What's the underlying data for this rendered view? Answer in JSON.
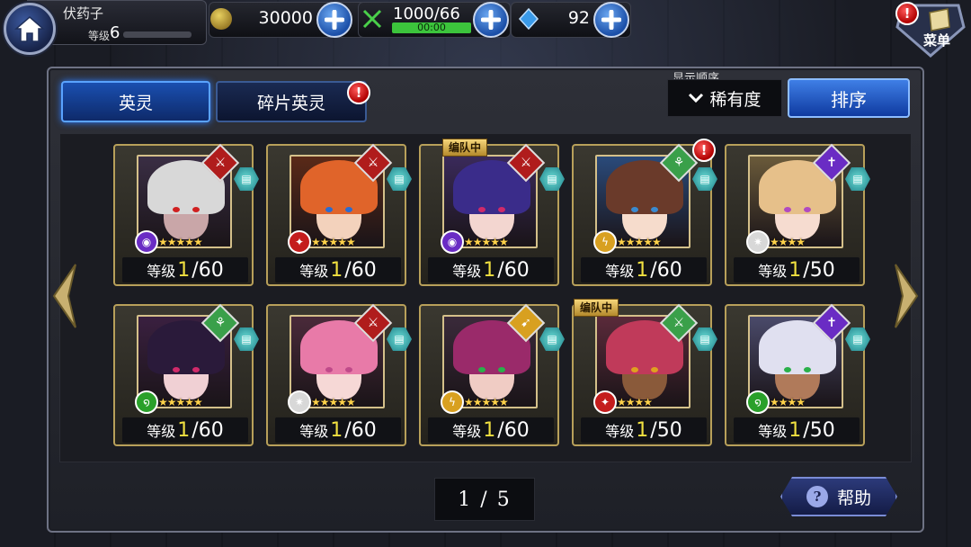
{
  "player": {
    "name": "伏药子",
    "level_label": "等级",
    "level": "6",
    "exp_progress": 0.0
  },
  "resources": {
    "coins": "30000",
    "stamina": "1000/66",
    "stamina_timer": "00:00",
    "gems": "92"
  },
  "menu": {
    "label": "菜单"
  },
  "tabs": [
    {
      "label": "英灵",
      "active": true
    },
    {
      "label": "碎片英灵",
      "active": false,
      "alert": "!"
    }
  ],
  "sort": {
    "caption": "显示顺序",
    "current": "稀有度",
    "button_label": "排序"
  },
  "heroes": [
    {
      "level_label": "等级",
      "level": "1",
      "max": "/60",
      "stars": "★★★★★",
      "class_color": "#b01c1c",
      "class_glyph": "⚔",
      "element_color": "#6a2cc4",
      "element_glyph": "◉",
      "hair": "#d8d8d8",
      "skin": "#c9a6a8",
      "eye": "#d02020",
      "bg": "#3a2e44"
    },
    {
      "level_label": "等级",
      "level": "1",
      "max": "/60",
      "stars": "★★★★★",
      "class_color": "#b01c1c",
      "class_glyph": "⚔",
      "element_color": "#c41c1c",
      "element_glyph": "✦",
      "hair": "#e0642a",
      "skin": "#f3d2bc",
      "eye": "#2a6cd0",
      "bg": "#5a2a18"
    },
    {
      "level_label": "等级",
      "level": "1",
      "max": "/60",
      "stars": "★★★★★",
      "class_color": "#b01c1c",
      "class_glyph": "⚔",
      "element_color": "#6a2cc4",
      "element_glyph": "◉",
      "hair": "#3a2c8a",
      "skin": "#f3d6d0",
      "eye": "#d02a6a",
      "bg": "#3a2a5a",
      "in_party": "编队中"
    },
    {
      "level_label": "等级",
      "level": "1",
      "max": "/60",
      "stars": "★★★★★",
      "class_color": "#3aa04a",
      "class_glyph": "⚘",
      "element_color": "#d8a020",
      "element_glyph": "ϟ",
      "hair": "#6a3a2a",
      "skin": "#f6dccc",
      "eye": "#3a8ad0",
      "bg": "#2a4a7a",
      "alert": "!"
    },
    {
      "level_label": "等级",
      "level": "1",
      "max": "/50",
      "stars": "★★★★",
      "class_color": "#6a2cc4",
      "class_glyph": "✝",
      "element_color": "#d8d8d8",
      "element_glyph": "✷",
      "hair": "#e6c08a",
      "skin": "#f6dcd0",
      "eye": "#b04ac0",
      "bg": "#6a5a3a"
    },
    {
      "level_label": "等级",
      "level": "1",
      "max": "/60",
      "stars": "★★★★★",
      "class_color": "#3aa04a",
      "class_glyph": "⚘",
      "element_color": "#2aa02a",
      "element_glyph": "໑",
      "hair": "#2a1a3a",
      "skin": "#f0d0d4",
      "eye": "#d02a6a",
      "bg": "#3a2040"
    },
    {
      "level_label": "等级",
      "level": "1",
      "max": "/60",
      "stars": "★★★★★",
      "class_color": "#b01c1c",
      "class_glyph": "⚔",
      "element_color": "#d8d8d8",
      "element_glyph": "✷",
      "hair": "#e87aa8",
      "skin": "#f6d8d6",
      "eye": "#c04a8a",
      "bg": "#4a2a3a"
    },
    {
      "level_label": "等级",
      "level": "1",
      "max": "/60",
      "stars": "★★★★★",
      "class_color": "#d8a020",
      "class_glyph": "➹",
      "element_color": "#d8a020",
      "element_glyph": "ϟ",
      "hair": "#9a2a6a",
      "skin": "#f0ccc4",
      "eye": "#2ab04a",
      "bg": "#3a2a3a"
    },
    {
      "level_label": "等级",
      "level": "1",
      "max": "/50",
      "stars": "★★★★",
      "class_color": "#3aa04a",
      "class_glyph": "⚔",
      "element_color": "#c41c1c",
      "element_glyph": "✦",
      "hair": "#c03a5a",
      "skin": "#8a5a3a",
      "eye": "#e0a020",
      "bg": "#5a2a3a",
      "in_party": "编队中"
    },
    {
      "level_label": "等级",
      "level": "1",
      "max": "/50",
      "stars": "★★★★",
      "class_color": "#6a2cc4",
      "class_glyph": "✝",
      "element_color": "#2aa02a",
      "element_glyph": "໑",
      "hair": "#e0e0f0",
      "skin": "#b07a5a",
      "eye": "#2ab04a",
      "bg": "#4a4a6a"
    }
  ],
  "pagination": {
    "text": "1 / 5"
  },
  "help": {
    "label": "帮助"
  },
  "colors": {
    "accent_blue": "#1a4fb0",
    "gold_border": "#b8a05a",
    "level_yellow": "#f0e040"
  }
}
